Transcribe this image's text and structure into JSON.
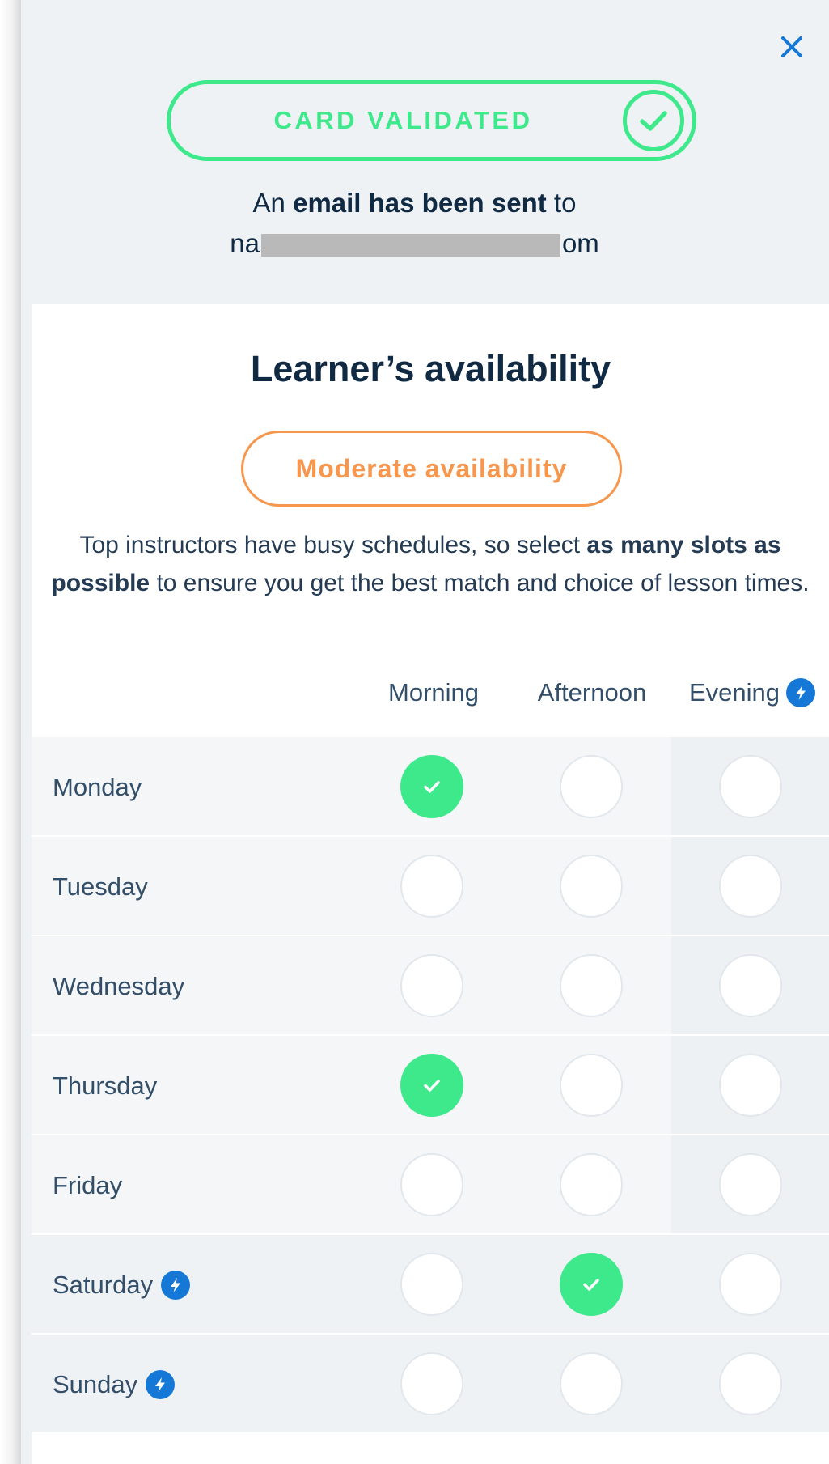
{
  "colors": {
    "accent_green": "#3ee98c",
    "accent_orange": "#f7964d",
    "bolt_blue": "#1678d6",
    "text_dark": "#102a43"
  },
  "status": {
    "label": "CARD VALIDATED",
    "icon": "check-circle-icon"
  },
  "email_notice": {
    "prefix": "An ",
    "bold": "email has been sent",
    "suffix": " to",
    "address_start": "na",
    "address_end": "om"
  },
  "availability": {
    "title": "Learner’s availability",
    "level": "Moderate availability",
    "desc_part1": "Top instructors have busy schedules, so select ",
    "desc_bold": "as many slots as possible",
    "desc_part2": " to ensure you get the best match and choice of lesson times."
  },
  "columns": [
    {
      "label": "Morning",
      "bolt": false
    },
    {
      "label": "Afternoon",
      "bolt": false
    },
    {
      "label": "Evening",
      "bolt": true
    }
  ],
  "days": [
    {
      "label": "Monday",
      "bolt": false,
      "slots": [
        true,
        false,
        false
      ]
    },
    {
      "label": "Tuesday",
      "bolt": false,
      "slots": [
        false,
        false,
        false
      ]
    },
    {
      "label": "Wednesday",
      "bolt": false,
      "slots": [
        false,
        false,
        false
      ]
    },
    {
      "label": "Thursday",
      "bolt": false,
      "slots": [
        true,
        false,
        false
      ]
    },
    {
      "label": "Friday",
      "bolt": false,
      "slots": [
        false,
        false,
        false
      ]
    },
    {
      "label": "Saturday",
      "bolt": true,
      "slots": [
        false,
        true,
        false
      ]
    },
    {
      "label": "Sunday",
      "bolt": true,
      "slots": [
        false,
        false,
        false
      ]
    }
  ]
}
